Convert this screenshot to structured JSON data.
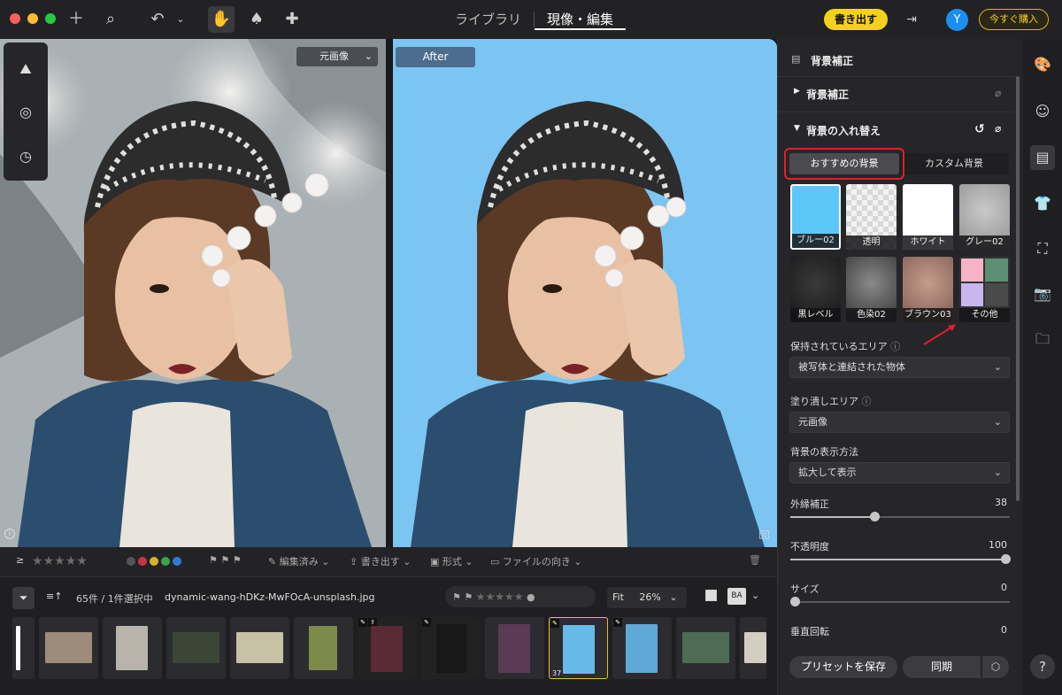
{
  "colors": {
    "accent_yellow": "#f5d21a",
    "selection_red": "#e0202a",
    "after_bg": "#7cc5f2"
  },
  "header": {
    "tabs": [
      {
        "label": "ライブラリ"
      },
      {
        "label": "現像・編集"
      }
    ],
    "export_label": "書き出す",
    "avatar_initial": "Y",
    "buy_label": "今すぐ購入"
  },
  "viewer": {
    "left_select": "元画像",
    "right_label": "After"
  },
  "rating_bar": {
    "edited": "編集済み",
    "export": "書き出す",
    "format": "形式",
    "orientation": "ファイルの向き"
  },
  "filmstrip": {
    "count": "65件 / 1件選択中",
    "filename": "dynamic-wang-hDKz-MwFOcA-unsplash.jpg",
    "fit": "Fit",
    "zoom": "26%",
    "compare": "BA",
    "selected_number": "37"
  },
  "panel": {
    "title": "背景補正",
    "section1": "背景補正",
    "section2": "背景の入れ替え",
    "tab_recommended": "おすすめの背景",
    "tab_custom": "カスタム背景",
    "backgrounds": [
      {
        "label": "ブルー02"
      },
      {
        "label": "透明"
      },
      {
        "label": "ホワイト"
      },
      {
        "label": "グレー02"
      },
      {
        "label": "黒レベル"
      },
      {
        "label": "色染02"
      },
      {
        "label": "ブラウン03"
      },
      {
        "label": "その他"
      }
    ],
    "keep_area_label": "保持されているエリア",
    "keep_area_value": "被写体と連結された物体",
    "fill_area_label": "塗り潰しエリア",
    "fill_area_value": "元画像",
    "display_label": "背景の表示方法",
    "display_value": "拡大して表示",
    "edge_label": "外縁補正",
    "edge_value": "38",
    "opacity_label": "不透明度",
    "opacity_value": "100",
    "size_label": "サイズ",
    "size_value": "0",
    "vflip_label": "垂直回転",
    "vflip_value": "0",
    "save_preset": "プリセットを保存",
    "sync": "同期"
  }
}
